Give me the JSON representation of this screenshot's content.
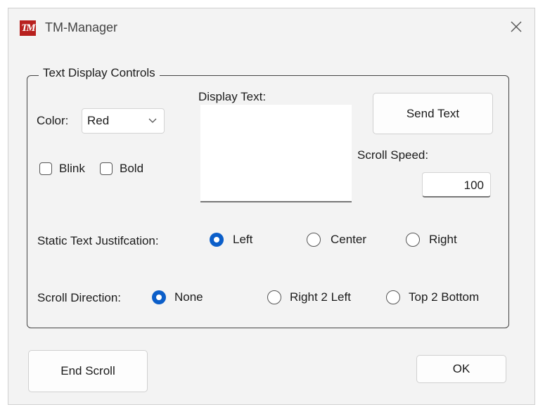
{
  "window": {
    "title": "TM-Manager",
    "logo_text": "TM"
  },
  "group": {
    "legend": "Text Display Controls"
  },
  "color": {
    "label": "Color:",
    "selected": "Red"
  },
  "options": {
    "blink_label": "Blink",
    "blink_checked": false,
    "bold_label": "Bold",
    "bold_checked": false
  },
  "display_text": {
    "label": "Display Text:",
    "value": ""
  },
  "send_button": "Send Text",
  "scroll_speed": {
    "label": "Scroll Speed:",
    "value": "100"
  },
  "justification": {
    "label": "Static Text Justifcation:",
    "options": [
      {
        "label": "Left",
        "selected": true
      },
      {
        "label": "Center",
        "selected": false
      },
      {
        "label": "Right",
        "selected": false
      }
    ]
  },
  "scroll_direction": {
    "label": "Scroll Direction:",
    "options": [
      {
        "label": "None",
        "selected": true
      },
      {
        "label": "Right 2 Left",
        "selected": false
      },
      {
        "label": "Top 2 Bottom",
        "selected": false
      }
    ]
  },
  "footer": {
    "end_scroll": "End Scroll",
    "ok": "OK"
  },
  "colors": {
    "accent": "#0b5ec9",
    "logo": "#b8201e",
    "background": "#f3f3f3"
  }
}
